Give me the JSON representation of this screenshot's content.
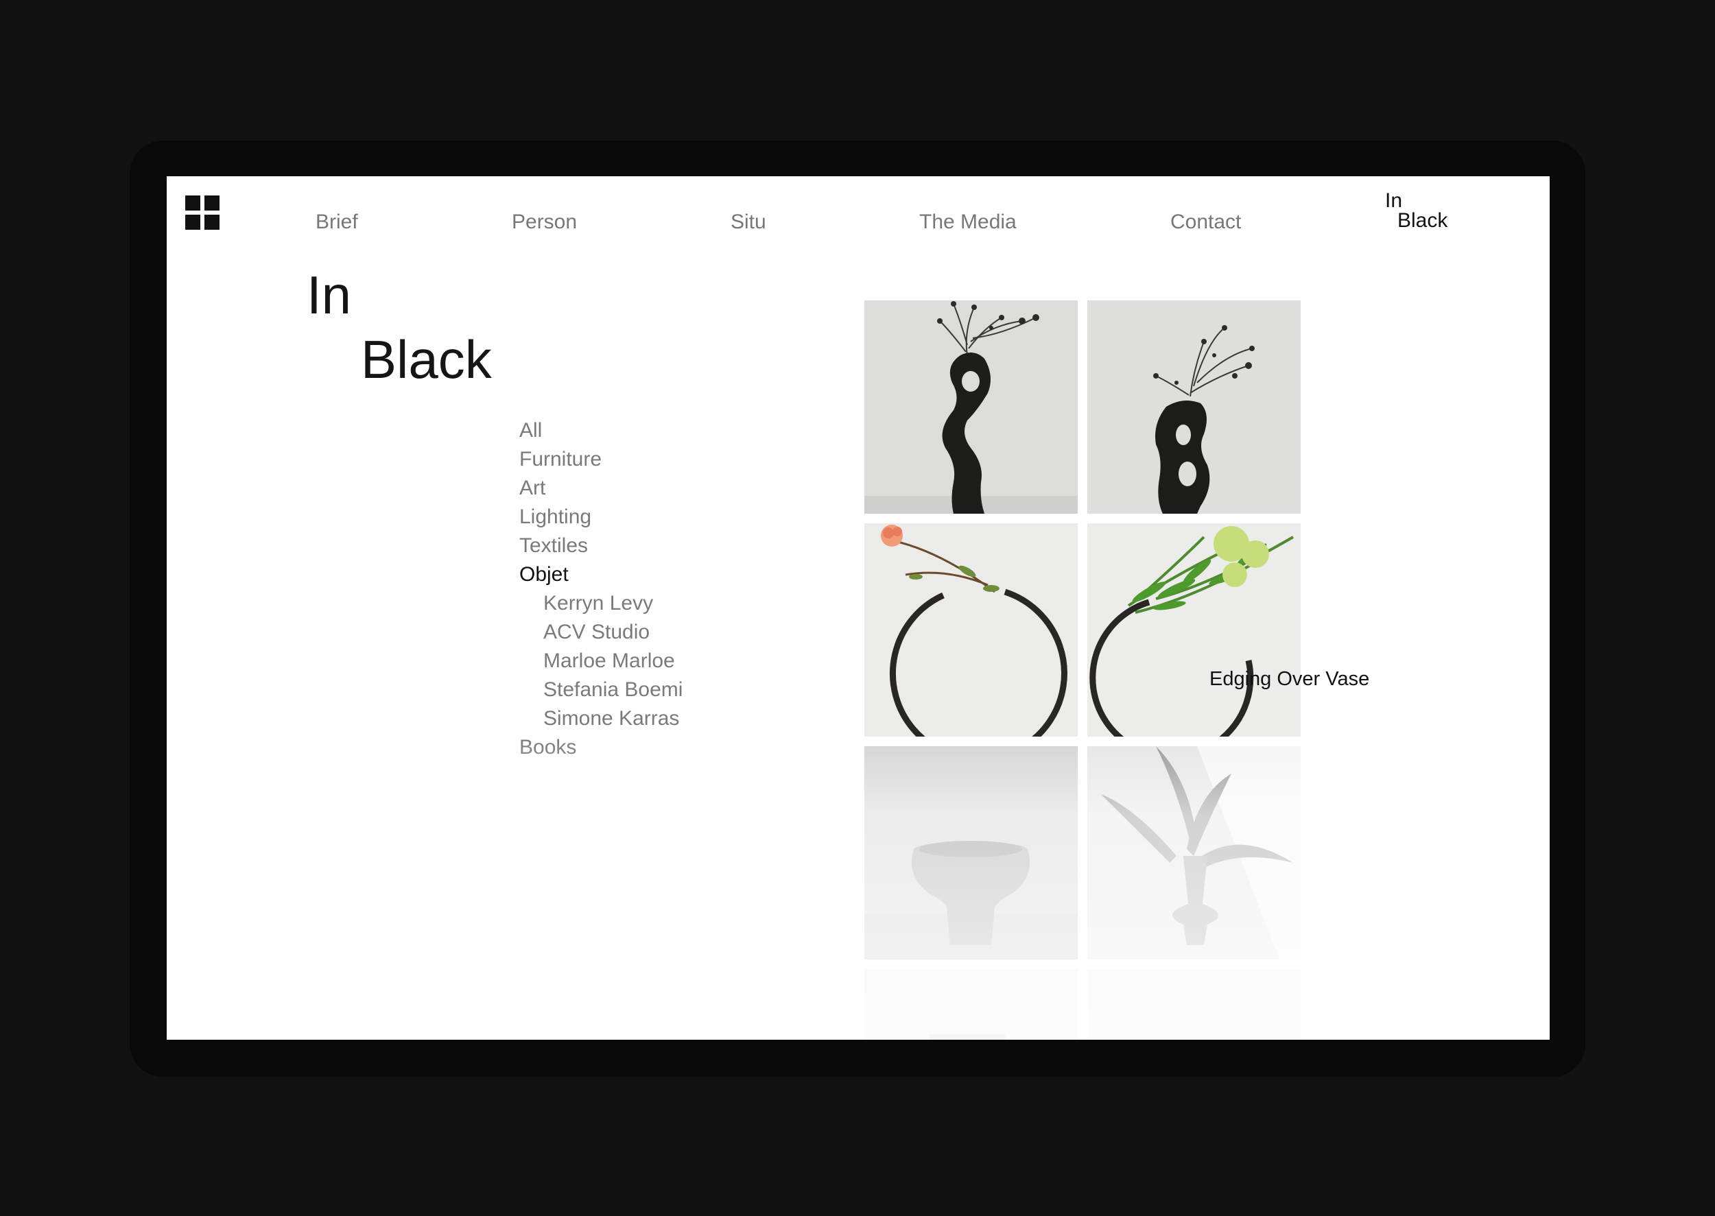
{
  "nav": {
    "items": [
      "Brief",
      "Person",
      "Situ",
      "The Media",
      "Contact"
    ],
    "brand_line1": "In",
    "brand_line2": "Black"
  },
  "page": {
    "title_line1": "In",
    "title_line2": "Black",
    "hover_caption": "Edging Over Vase"
  },
  "categories": [
    {
      "label": "All",
      "active": false,
      "sub": false
    },
    {
      "label": "Furniture",
      "active": false,
      "sub": false
    },
    {
      "label": "Art",
      "active": false,
      "sub": false
    },
    {
      "label": "Lighting",
      "active": false,
      "sub": false
    },
    {
      "label": "Textiles",
      "active": false,
      "sub": false
    },
    {
      "label": "Objet",
      "active": true,
      "sub": false
    },
    {
      "label": "Kerryn Levy",
      "active": false,
      "sub": true
    },
    {
      "label": "ACV Studio",
      "active": false,
      "sub": true
    },
    {
      "label": "Marloe Marloe",
      "active": false,
      "sub": true
    },
    {
      "label": "Stefania Boemi",
      "active": false,
      "sub": true
    },
    {
      "label": "Simone Karras",
      "active": false,
      "sub": true
    },
    {
      "label": "Books",
      "active": false,
      "sub": false
    }
  ],
  "products": [
    {
      "image": "black-sculptural-vase-with-dried-stems"
    },
    {
      "image": "black-vase-with-two-holes-and-dried-stems"
    },
    {
      "image": "ring-vase-with-orange-flower"
    },
    {
      "image": "ring-vase-with-green-flowers"
    },
    {
      "image": "grey-round-ceramic-bowl-vase"
    },
    {
      "image": "grey-vase-with-bird-of-paradise-leaves"
    },
    {
      "image": "product-image"
    },
    {
      "image": "product-image"
    }
  ],
  "colors": {
    "background": "#121212",
    "device": "#090909",
    "screen": "#ffffff",
    "text": "#111111",
    "muted": "#777777"
  }
}
